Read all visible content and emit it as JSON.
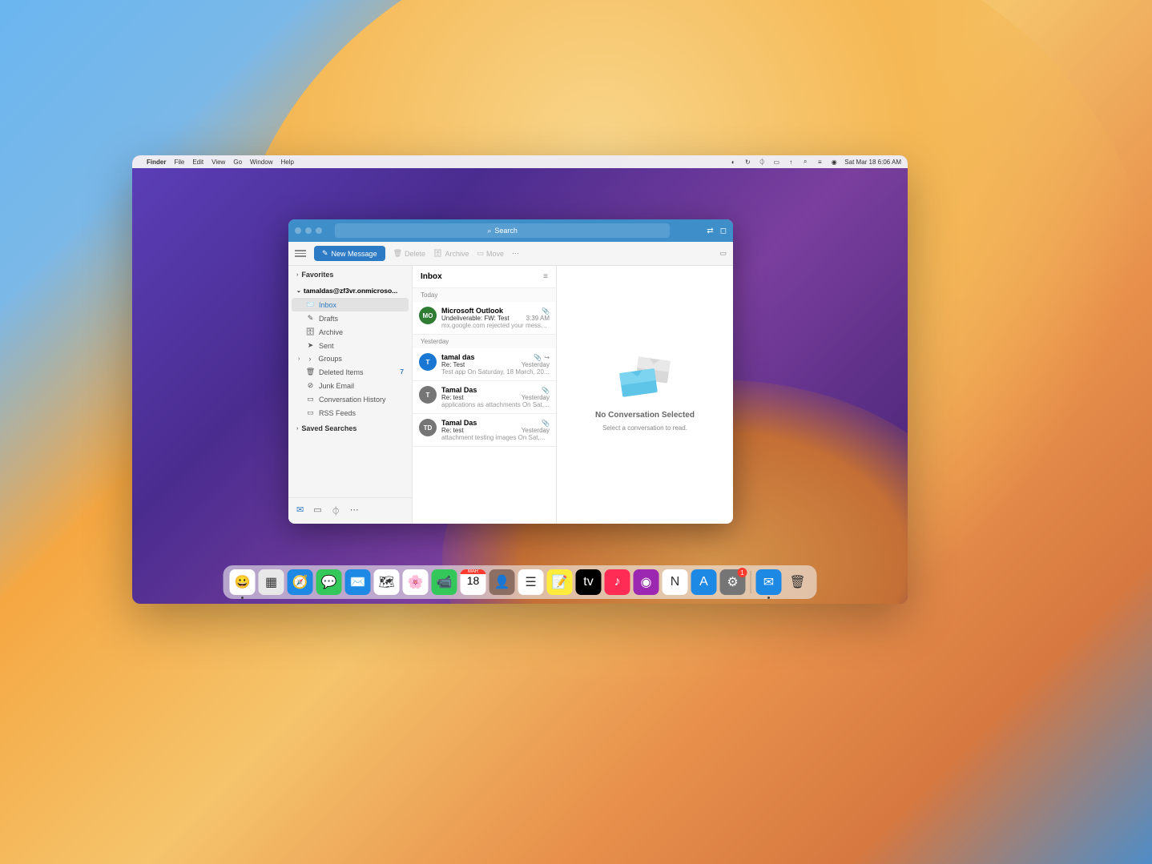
{
  "menubar": {
    "app": "Finder",
    "items": [
      "File",
      "Edit",
      "View",
      "Go",
      "Window",
      "Help"
    ],
    "datetime": "Sat Mar 18  6:06 AM"
  },
  "outlook": {
    "search_placeholder": "Search",
    "toolbar": {
      "new_message": "New Message",
      "delete": "Delete",
      "archive": "Archive",
      "move": "Move"
    },
    "sidebar": {
      "favorites": "Favorites",
      "account": "tamaldas@zf3vr.onmicroso...",
      "folders": [
        {
          "icon": "📨",
          "label": "Inbox",
          "active": true
        },
        {
          "icon": "✎",
          "label": "Drafts"
        },
        {
          "icon": "🗄",
          "label": "Archive"
        },
        {
          "icon": "➤",
          "label": "Sent"
        },
        {
          "icon": "›",
          "label": "Groups",
          "expandable": true
        },
        {
          "icon": "🗑",
          "label": "Deleted Items",
          "badge": "7"
        },
        {
          "icon": "⊘",
          "label": "Junk Email"
        },
        {
          "icon": "▭",
          "label": "Conversation History"
        },
        {
          "icon": "▭",
          "label": "RSS Feeds"
        }
      ],
      "saved_searches": "Saved Searches"
    },
    "msglist": {
      "title": "Inbox",
      "groups": [
        {
          "label": "Today",
          "items": [
            {
              "avatar": "MO",
              "color": "#2e7d32",
              "sender": "Microsoft Outlook",
              "subject": "Undeliverable: FW: Test",
              "time": "3:39 AM",
              "preview": "mx.google.com rejected your messa...",
              "attach": true
            }
          ]
        },
        {
          "label": "Yesterday",
          "items": [
            {
              "avatar": "T",
              "color": "#1976d2",
              "sender": "tamal das",
              "subject": "Re: Test",
              "time": "Yesterday",
              "preview": "Test app On Saturday, 18 March, 20...",
              "attach": true,
              "forward": true
            },
            {
              "avatar": "T",
              "color": "#757575",
              "sender": "Tamal Das",
              "subject": "Re: test",
              "time": "Yesterday",
              "preview": "applications as attachments On Sat,...",
              "attach": true
            },
            {
              "avatar": "TD",
              "color": "#757575",
              "sender": "Tamal Das",
              "subject": "Re: test",
              "time": "Yesterday",
              "preview": "attachment testing images On Sat,...",
              "attach": true
            }
          ]
        }
      ]
    },
    "reading": {
      "title": "No Conversation Selected",
      "subtitle": "Select a conversation to read."
    }
  },
  "dock": {
    "items": [
      {
        "name": "finder",
        "bg": "#ffffff",
        "emoji": "😀",
        "running": true
      },
      {
        "name": "launchpad",
        "bg": "#e8e8e8",
        "emoji": "▦"
      },
      {
        "name": "safari",
        "bg": "#1e88e5",
        "emoji": "🧭"
      },
      {
        "name": "messages",
        "bg": "#34c759",
        "emoji": "💬"
      },
      {
        "name": "mail",
        "bg": "#1e88e5",
        "emoji": "✉️"
      },
      {
        "name": "maps",
        "bg": "#ffffff",
        "emoji": "🗺"
      },
      {
        "name": "photos",
        "bg": "#ffffff",
        "emoji": "🌸"
      },
      {
        "name": "facetime",
        "bg": "#34c759",
        "emoji": "📹"
      },
      {
        "name": "calendar",
        "bg": "#ffffff",
        "emoji": "18",
        "text_top": "MAR",
        "is_cal": true
      },
      {
        "name": "contacts",
        "bg": "#8d6e63",
        "emoji": "👤"
      },
      {
        "name": "reminders",
        "bg": "#ffffff",
        "emoji": "☰"
      },
      {
        "name": "notes",
        "bg": "#ffeb3b",
        "emoji": "📝"
      },
      {
        "name": "tv",
        "bg": "#000000",
        "emoji": "tv"
      },
      {
        "name": "music",
        "bg": "#ff2d55",
        "emoji": "♪"
      },
      {
        "name": "podcasts",
        "bg": "#9c27b0",
        "emoji": "◉"
      },
      {
        "name": "news",
        "bg": "#ffffff",
        "emoji": "N"
      },
      {
        "name": "appstore",
        "bg": "#1e88e5",
        "emoji": "A"
      },
      {
        "name": "settings",
        "bg": "#757575",
        "emoji": "⚙",
        "badge": "1"
      }
    ],
    "right": [
      {
        "name": "outlook",
        "bg": "#1e88e5",
        "emoji": "✉",
        "running": true
      },
      {
        "name": "trash",
        "bg": "transparent",
        "emoji": "🗑"
      }
    ]
  }
}
